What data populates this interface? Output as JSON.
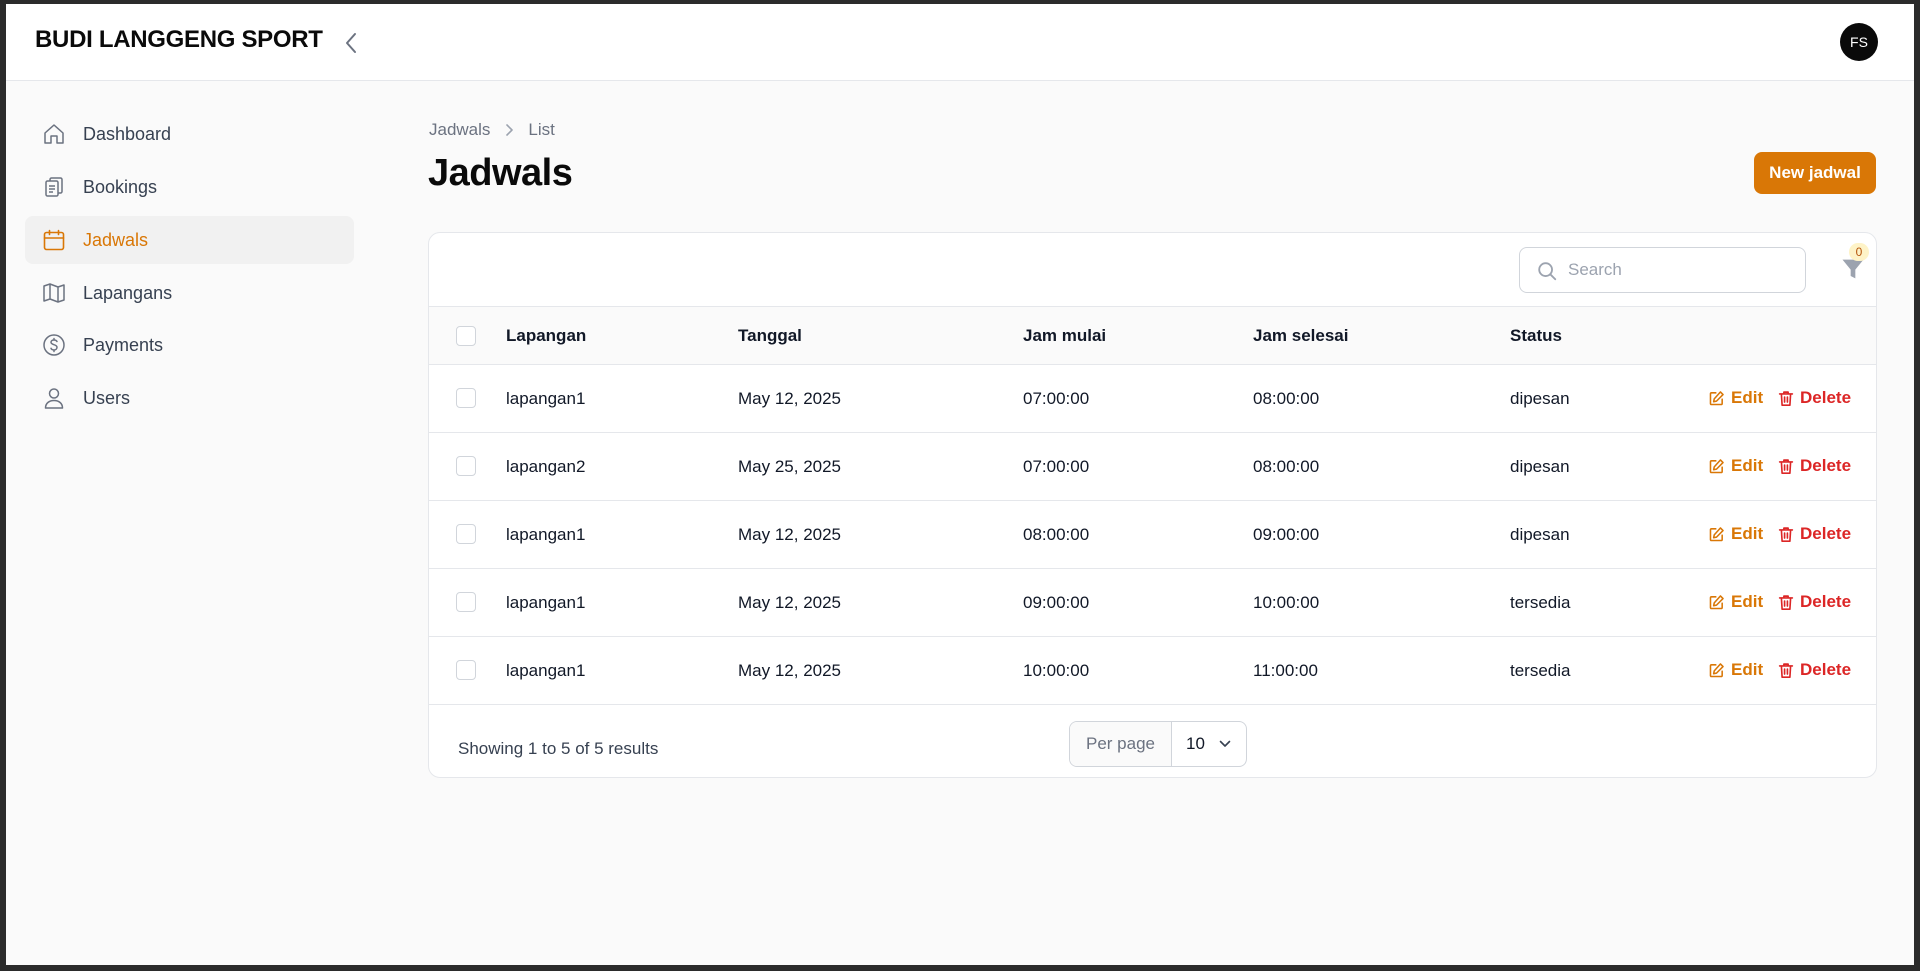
{
  "app": {
    "brand": "BUDI LANGGENG SPORT",
    "avatar_initials": "FS",
    "accent": "#d97706",
    "danger": "#dc2626"
  },
  "sidebar": {
    "items": [
      {
        "label": "Dashboard",
        "icon": "home-icon",
        "active": false
      },
      {
        "label": "Bookings",
        "icon": "clipboard-icon",
        "active": false
      },
      {
        "label": "Jadwals",
        "icon": "calendar-icon",
        "active": true
      },
      {
        "label": "Lapangans",
        "icon": "map-icon",
        "active": false
      },
      {
        "label": "Payments",
        "icon": "dollar-circle-icon",
        "active": false
      },
      {
        "label": "Users",
        "icon": "user-icon",
        "active": false
      }
    ]
  },
  "breadcrumb": {
    "parent": "Jadwals",
    "current": "List"
  },
  "page": {
    "title": "Jadwals",
    "new_button": "New jadwal"
  },
  "toolbar": {
    "search_placeholder": "Search",
    "filter_count": "0"
  },
  "table": {
    "columns": [
      "Lapangan",
      "Tanggal",
      "Jam mulai",
      "Jam selesai",
      "Status"
    ],
    "edit_label": "Edit",
    "delete_label": "Delete",
    "rows": [
      {
        "lapangan": "lapangan1",
        "tanggal": "May 12, 2025",
        "jam_mulai": "07:00:00",
        "jam_selesai": "08:00:00",
        "status": "dipesan"
      },
      {
        "lapangan": "lapangan2",
        "tanggal": "May 25, 2025",
        "jam_mulai": "07:00:00",
        "jam_selesai": "08:00:00",
        "status": "dipesan"
      },
      {
        "lapangan": "lapangan1",
        "tanggal": "May 12, 2025",
        "jam_mulai": "08:00:00",
        "jam_selesai": "09:00:00",
        "status": "dipesan"
      },
      {
        "lapangan": "lapangan1",
        "tanggal": "May 12, 2025",
        "jam_mulai": "09:00:00",
        "jam_selesai": "10:00:00",
        "status": "tersedia"
      },
      {
        "lapangan": "lapangan1",
        "tanggal": "May 12, 2025",
        "jam_mulai": "10:00:00",
        "jam_selesai": "11:00:00",
        "status": "tersedia"
      }
    ]
  },
  "pagination": {
    "summary": "Showing 1 to 5 of 5 results",
    "per_page_label": "Per page",
    "per_page_value": "10"
  }
}
